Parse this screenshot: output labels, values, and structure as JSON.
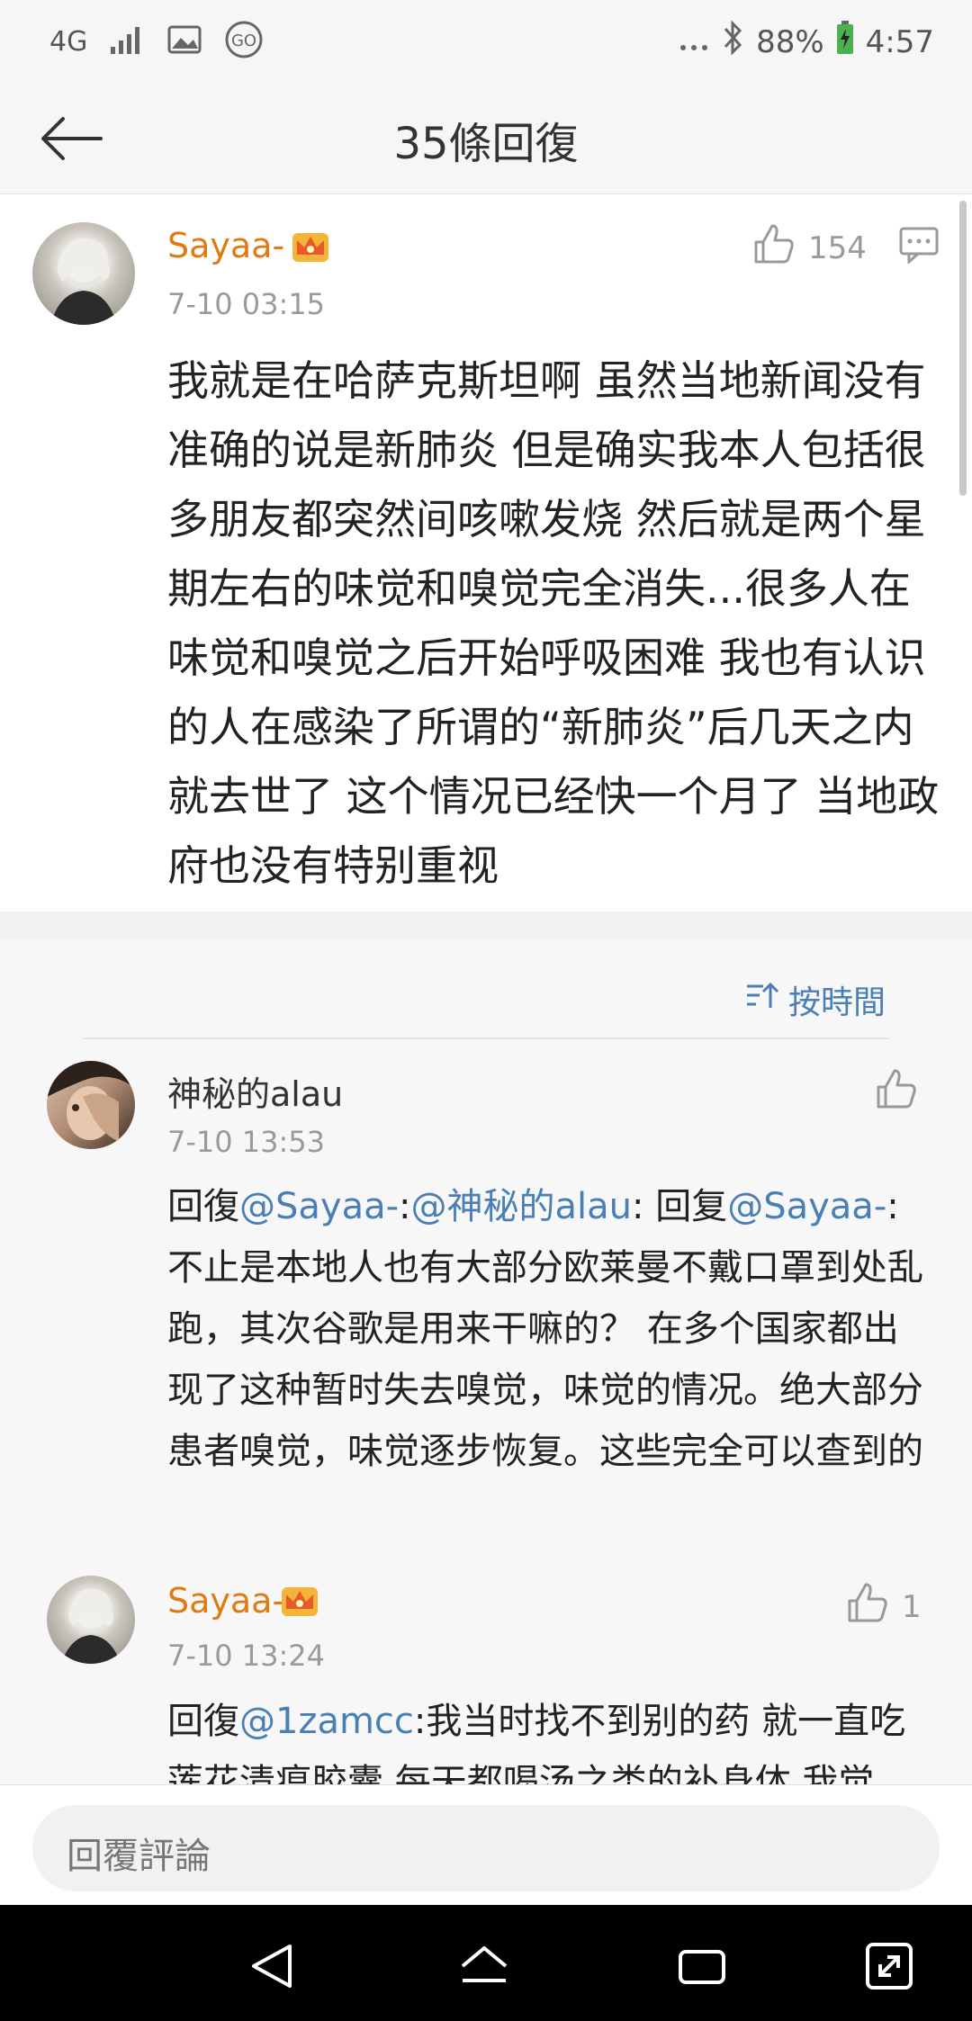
{
  "status_bar": {
    "network": "4G",
    "battery_percent": "88%",
    "time": "4:57",
    "icons": [
      "signal-icon",
      "image-icon",
      "go-icon",
      "more-dots-icon",
      "bluetooth-icon",
      "battery-charging-icon"
    ]
  },
  "nav": {
    "title": "35條回復"
  },
  "main_comment": {
    "username": "Sayaa-",
    "time": "7-10 03:15",
    "likes": "154",
    "text": "我就是在哈萨克斯坦啊 虽然当地新闻没有准确的说是新肺炎 但是确实我本人包括很多朋友都突然间咳嗽发烧 然后就是两个星期左右的味觉和嗅觉完全消失...很多人在味觉和嗅觉之后开始呼吸困难 我也有认识的人在感染了所谓的“新肺炎”后几天之内就去世了 这个情况已经快一个月了 当地政府也没有特别重视"
  },
  "sort": {
    "label": "按時間"
  },
  "replies": [
    {
      "username": "神秘的alau",
      "time": "7-10 13:53",
      "likes": "",
      "prefix": "回復",
      "mention1": "@Sayaa-",
      "sep1": ":",
      "mention2": "@神秘的alau",
      "sep2": ": 回复",
      "mention3": "@Sayaa-",
      "body": ":不止是本地人也有大部分欧莱曼不戴口罩到处乱跑，其次谷歌是用来干嘛的？ 在多个国家都出现了这种暂时失去嗅觉，味觉的情况。绝大部分患者嗅觉，味觉逐步恢复。这些完全可以查到的"
    },
    {
      "username": "Sayaa-",
      "time": "7-10 13:24",
      "likes": "1",
      "prefix": "回復",
      "mention1": "@1zamcc",
      "body": ":我当时找不到别的药 就一直吃莲花清瘟胶囊 每天都喝汤之类的补身体 我觉"
    }
  ],
  "input": {
    "placeholder": "回覆評論"
  },
  "colors": {
    "accent_orange": "#e07a12",
    "link_blue": "#4a7fb5"
  }
}
